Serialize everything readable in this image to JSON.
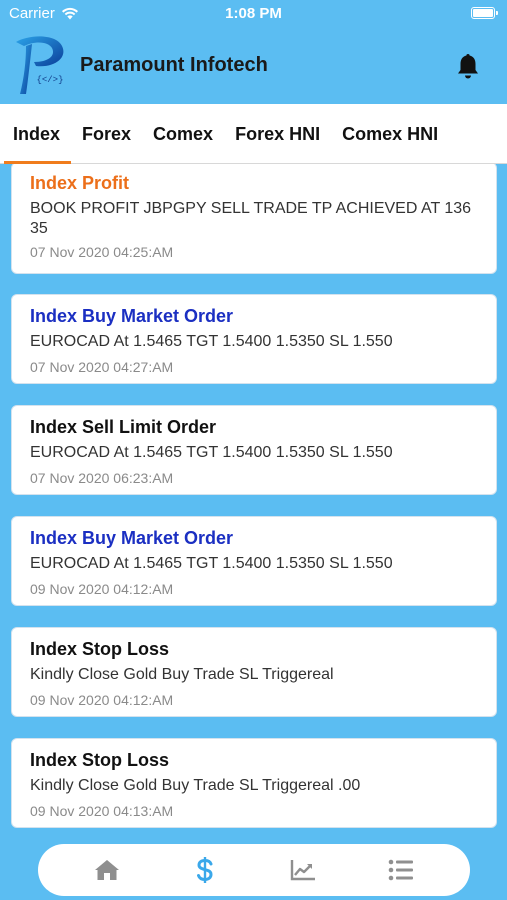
{
  "status_bar": {
    "carrier": "Carrier",
    "time": "1:08 PM"
  },
  "header": {
    "title": "Paramount Infotech",
    "logo_text": "{</>}"
  },
  "tabs": [
    {
      "label": "Index",
      "active": true
    },
    {
      "label": "Forex",
      "active": false
    },
    {
      "label": "Comex",
      "active": false
    },
    {
      "label": "Forex HNI",
      "active": false
    },
    {
      "label": "Comex HNI",
      "active": false
    }
  ],
  "messages": [
    {
      "title": "Index Profit",
      "color": "#ec6f1a",
      "text": "BOOK PROFIT JBPGPY SELL TRADE TP ACHIEVED AT 136 35",
      "time": "07 Nov 2020 04:25:AM"
    },
    {
      "title": "Index Buy Market Order",
      "color": "#1b2fc2",
      "text": "EUROCAD At 1.5465 TGT 1.5400 1.5350 SL 1.550",
      "time": "07 Nov 2020 04:27:AM"
    },
    {
      "title": "Index Sell Limit Order",
      "color": "#111111",
      "text": "EUROCAD At 1.5465 TGT 1.5400 1.5350 SL 1.550",
      "time": "07 Nov 2020 06:23:AM"
    },
    {
      "title": "Index Buy Market Order",
      "color": "#1b2fc2",
      "text": "EUROCAD At 1.5465 TGT 1.5400 1.5350 SL 1.550",
      "time": "09 Nov 2020 04:12:AM"
    },
    {
      "title": "Index Stop Loss",
      "color": "#111111",
      "text": "Kindly Close Gold Buy Trade SL Triggereal",
      "time": "09 Nov 2020 04:12:AM"
    },
    {
      "title": "Index Stop Loss",
      "color": "#111111",
      "text": "Kindly Close Gold Buy Trade SL Triggereal .00",
      "time": "09 Nov 2020 04:13:AM"
    }
  ],
  "bottom_nav": [
    {
      "icon": "home-icon",
      "active": false
    },
    {
      "icon": "dollar-icon",
      "active": true
    },
    {
      "icon": "chart-icon",
      "active": false
    },
    {
      "icon": "list-icon",
      "active": false
    }
  ],
  "colors": {
    "background": "#5bbdf2",
    "active_tab_underline": "#f07c1d",
    "active_nav": "#3aa8ea",
    "inactive_nav": "#8f8f8f"
  }
}
